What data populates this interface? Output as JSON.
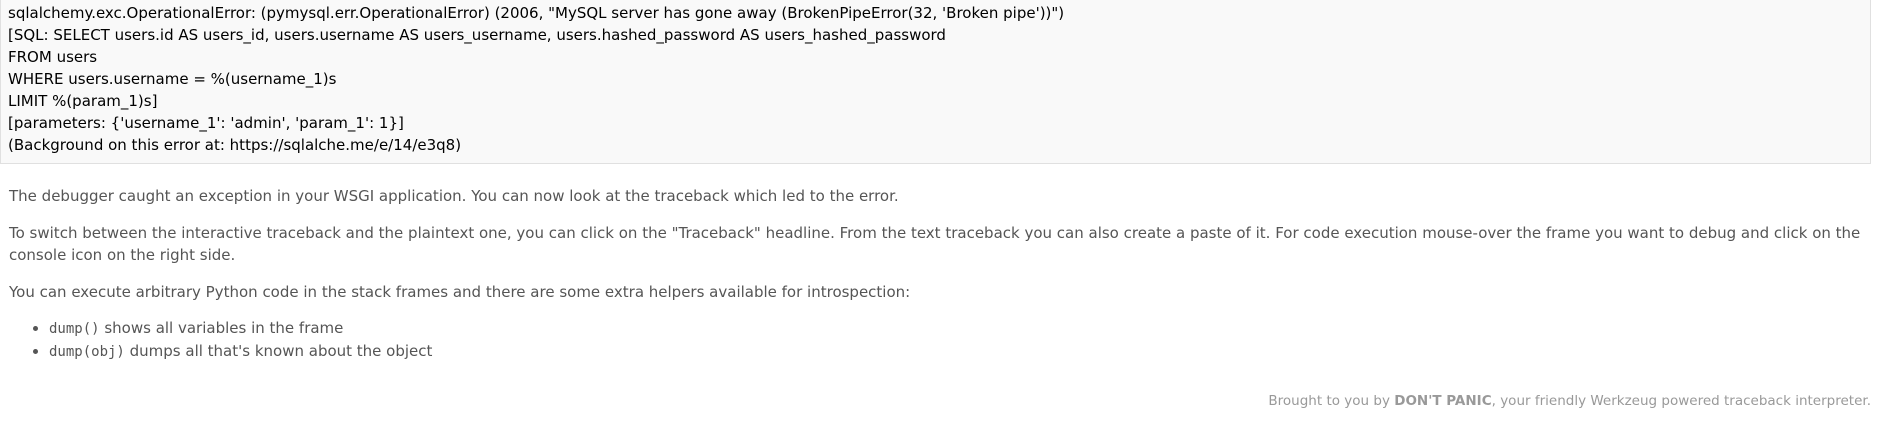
{
  "error": {
    "lines": [
      "sqlalchemy.exc.OperationalError: (pymysql.err.OperationalError) (2006, \"MySQL server has gone away (BrokenPipeError(32, 'Broken pipe'))\")",
      "[SQL: SELECT users.id AS users_id, users.username AS users_username, users.hashed_password AS users_hashed_password",
      "FROM users",
      "WHERE users.username = %(username_1)s",
      "LIMIT %(param_1)s]",
      "[parameters: {'username_1': 'admin', 'param_1': 1}]",
      "(Background on this error at: https://sqlalche.me/e/14/e3q8)"
    ]
  },
  "explanation": {
    "p1": "The debugger caught an exception in your WSGI application. You can now look at the traceback which led to the error.",
    "p2": "To switch between the interactive traceback and the plaintext one, you can click on the \"Traceback\" headline. From the text traceback you can also create a paste of it. For code execution mouse-over the frame you want to debug and click on the console icon on the right side.",
    "p3": "You can execute arbitrary Python code in the stack frames and there are some extra helpers available for introspection:",
    "helpers": [
      {
        "code": "dump()",
        "text": " shows all variables in the frame"
      },
      {
        "code": "dump(obj)",
        "text": " dumps all that's known about the object"
      }
    ]
  },
  "footer": {
    "prefix": "Brought to you by ",
    "brand": "DON'T PANIC",
    "suffix": ", your friendly Werkzeug powered traceback interpreter."
  }
}
